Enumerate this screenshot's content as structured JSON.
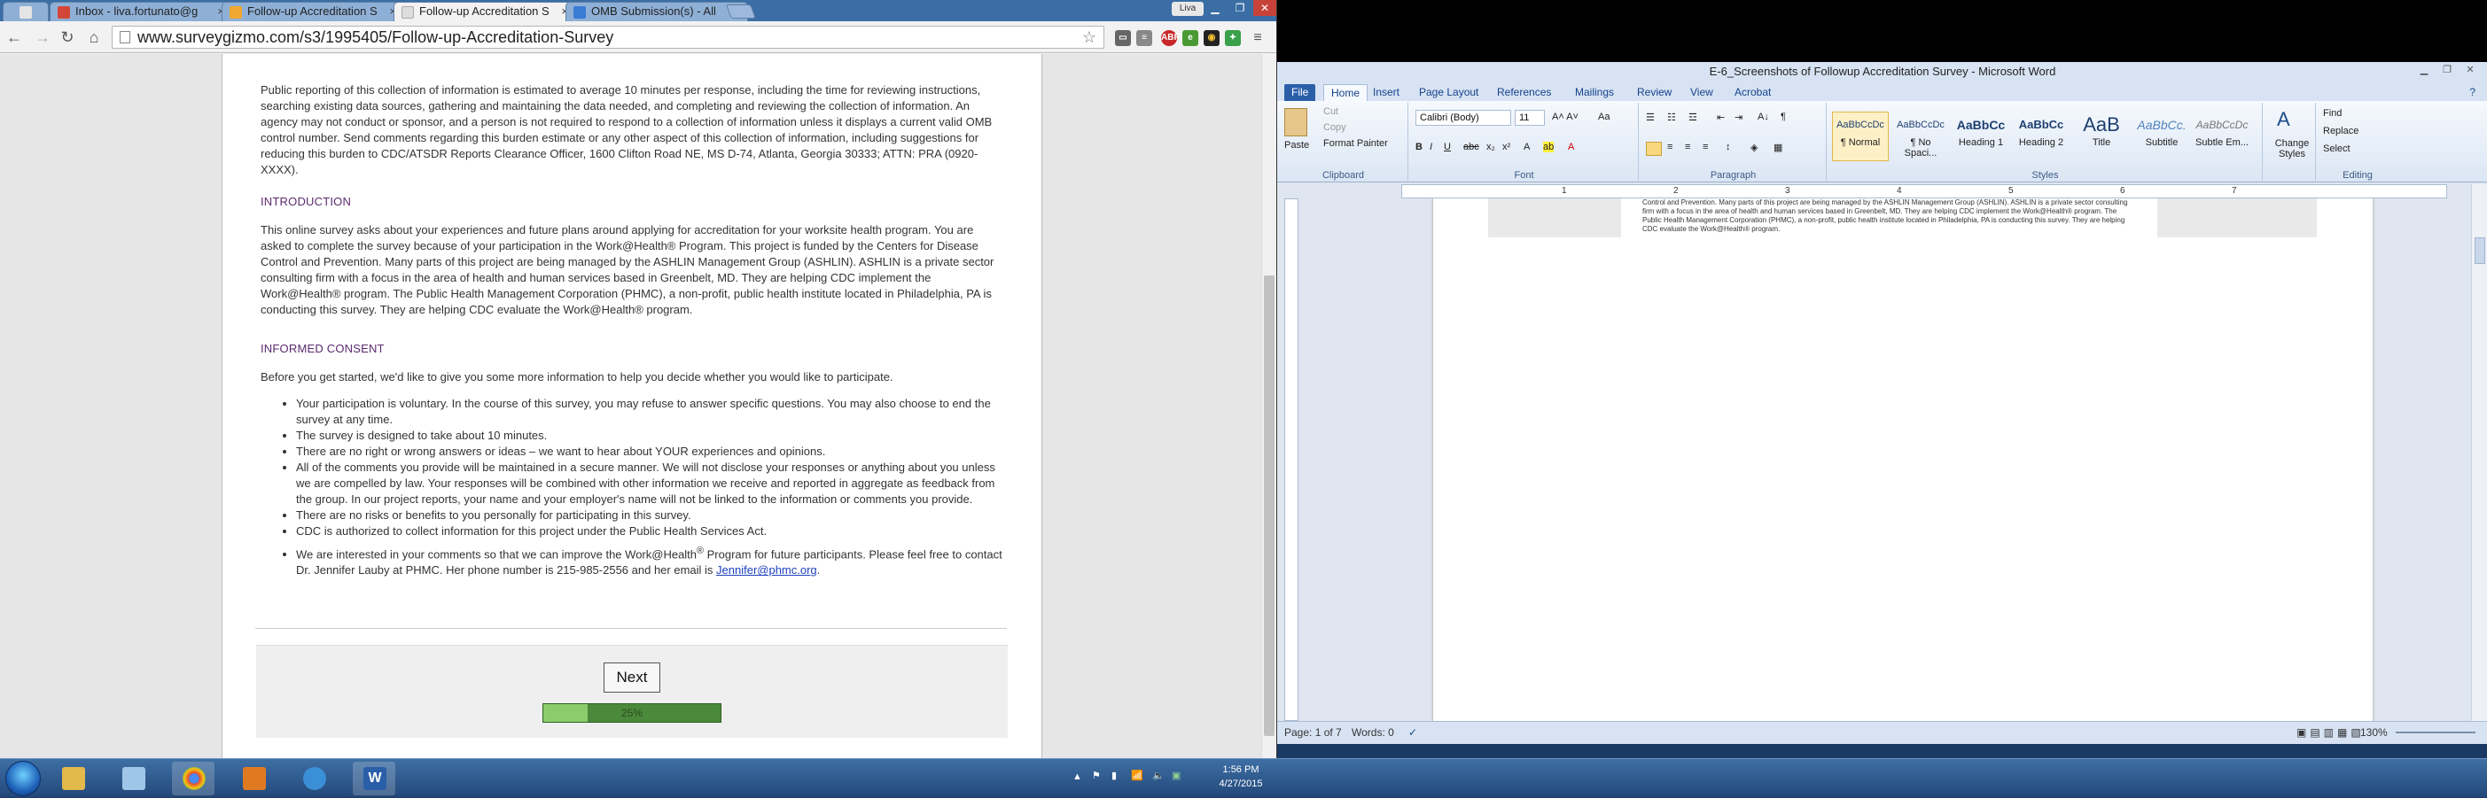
{
  "chrome": {
    "tabs": [
      {
        "title": "Inbox - liva.fortunato@g"
      },
      {
        "title": "Follow-up Accreditation S"
      },
      {
        "title": "Follow-up Accreditation S"
      },
      {
        "title": "OMB Submission(s) - All"
      }
    ],
    "user": "Liva",
    "url": "www.surveygizmo.com/s3/1995405/Follow-up-Accreditation-Survey"
  },
  "survey": {
    "burden": "Public reporting of this collection of information is estimated to average 10 minutes per response, including the time for reviewing instructions, searching existing data sources, gathering and maintaining the data needed, and completing and reviewing the collection of information. An agency may not conduct or sponsor, and a person is not required to respond to a collection of information unless it displays a current valid OMB control number.  Send comments regarding this burden estimate or any other aspect of this collection of information, including suggestions for reducing this burden to CDC/ATSDR Reports Clearance Officer, 1600 Clifton Road NE, MS D-74, Atlanta, Georgia 30333; ATTN: PRA (0920-XXXX).",
    "intro_heading": "INTRODUCTION",
    "intro_text": "This online survey asks about your experiences and future plans around applying for accreditation for your worksite health program. You are asked to complete the survey because of your participation in the Work@Health® Program.  This project is funded by the Centers for Disease Control and Prevention. Many parts of this project are being managed by the ASHLIN Management Group (ASHLIN). ASHLIN is a private sector consulting firm with a focus in the area of health and human services based in Greenbelt, MD. They are helping CDC implement the Work@Health® program.  The Public Health Management Corporation (PHMC), a non-profit, public health institute located in Philadelphia, PA is conducting this survey.  They are helping CDC evaluate the Work@Health® program.",
    "consent_heading": "INFORMED CONSENT",
    "consent_lead": "Before you get started, we'd like to give you some more information to help you decide whether you would like to participate.",
    "bullets": [
      "Your participation is voluntary.  In the course of this survey, you may refuse to answer specific questions. You may also choose to end the survey at any time.",
      "The survey is designed to take about 10 minutes.",
      "There are no right or wrong answers or ideas – we want to hear about YOUR experiences and opinions.",
      "All of the comments you provide will be maintained in a secure manner.  We will not disclose your responses or anything about you unless we are compelled by law. Your responses will be combined with other information we receive and reported in aggregate as feedback from the group. In our project reports, your name and your employer's name will not be linked to the information or comments you provide.",
      "There are no risks or benefits to you personally for participating in this survey.",
      "CDC is authorized to collect information for this project under the Public Health Services Act."
    ],
    "last_bullet_a": "We are interested in your comments so that we can improve the Work@Health",
    "last_bullet_sup": "®",
    "last_bullet_b": " Program for future participants. Please feel free to contact Dr. Jennifer Lauby at PHMC.  Her phone number is 215-985-2556 and her email is ",
    "email": "Jennifer@phmc.org",
    "last_bullet_end": ".",
    "next_label": "Next",
    "progress_label": "25%",
    "progress": 0.25
  },
  "word": {
    "title": "E-6_Screenshots of Followup Accreditation Survey - Microsoft Word",
    "tabs": [
      "File",
      "Home",
      "Insert",
      "Page Layout",
      "References",
      "Mailings",
      "Review",
      "View",
      "Acrobat"
    ],
    "clipboard": {
      "paste": "Paste",
      "cut": "Cut",
      "copy": "Copy",
      "painter": "Format Painter"
    },
    "font": {
      "name": "Calibri (Body)",
      "size": "11"
    },
    "groups": [
      "Clipboard",
      "Font",
      "Paragraph",
      "Styles",
      "Editing"
    ],
    "styles": [
      {
        "sample": "AaBbCcDc",
        "name": "¶ Normal"
      },
      {
        "sample": "AaBbCcDc",
        "name": "¶ No Spaci..."
      },
      {
        "sample": "AaBbCc",
        "name": "Heading 1"
      },
      {
        "sample": "AaBbCc",
        "name": "Heading 2"
      },
      {
        "sample": "AaB",
        "name": "Title"
      },
      {
        "sample": "AaBbCc.",
        "name": "Subtitle"
      },
      {
        "sample": "AaBbCcDc",
        "name": "Subtle Em..."
      }
    ],
    "change_styles": "Change Styles",
    "editing": {
      "find": "Find",
      "replace": "Replace",
      "select": "Select"
    },
    "ruler": [
      "1",
      "2",
      "3",
      "4",
      "5",
      "6",
      "7",
      ""
    ],
    "doc_snippet": "Control and Prevention. Many parts of this project are being managed by the ASHLIN Management Group (ASHLIN). ASHLIN is a private sector consulting firm with a focus in the area of health and human services based in Greenbelt, MD. They are helping CDC implement the Work@Health® program.  The Public Health Management Corporation (PHMC), a non-profit, public health institute located in Philadelphia, PA is conducting this survey.  They are helping CDC evaluate the Work@Health® program.",
    "status": {
      "page": "Page: 1 of 7",
      "words": "Words: 0",
      "zoom": "130%"
    }
  },
  "taskbar": {
    "time": "1:56 PM",
    "date": "4/27/2015"
  }
}
